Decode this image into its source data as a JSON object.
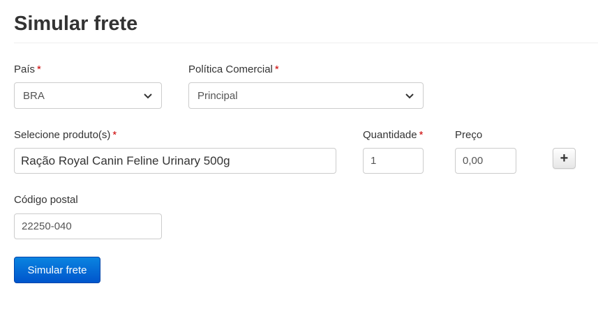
{
  "page": {
    "title": "Simular frete"
  },
  "form": {
    "country": {
      "label": "País",
      "required_mark": "*",
      "value": "BRA"
    },
    "commercial_policy": {
      "label": "Política Comercial",
      "required_mark": "*",
      "value": "Principal"
    },
    "product": {
      "label": "Selecione produto(s)",
      "required_mark": "*",
      "value": "Ração Royal Canin Feline Urinary 500g"
    },
    "quantity": {
      "label": "Quantidade",
      "required_mark": "*",
      "value": "1"
    },
    "price": {
      "label": "Preço",
      "value": "0,00"
    },
    "add_button": {
      "label": "+"
    },
    "postal_code": {
      "label": "Código postal",
      "value": "22250-040"
    },
    "submit": {
      "label": "Simular frete"
    }
  },
  "icons": {
    "select_chevron": "chevron-down-icon",
    "add": "plus-icon"
  },
  "colors": {
    "primary": "#0066cc",
    "required": "#cc0000",
    "border": "#cccccc"
  }
}
